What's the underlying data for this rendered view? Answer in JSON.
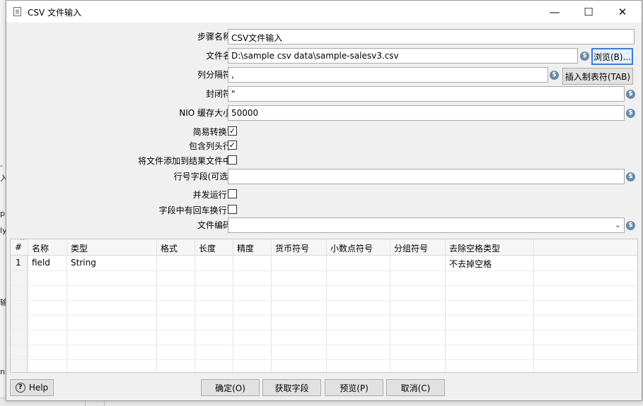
{
  "window": {
    "title": "CSV 文件输入",
    "minimize": "—",
    "maximize": "☐",
    "close": "✕"
  },
  "form": {
    "step_name": {
      "label": "步骤名称",
      "value": "CSV文件输入"
    },
    "filename": {
      "label": "文件名",
      "value": "D:\\sample csv data\\sample-salesv3.csv",
      "browse": "浏览(B)..."
    },
    "delimiter": {
      "label": "列分隔符",
      "value": ",",
      "insert_tab": "插入制表符(TAB)"
    },
    "enclosure": {
      "label": "封闭符",
      "value": "\""
    },
    "nio_buffer": {
      "label": "NIO 缓存大小",
      "value": "50000"
    },
    "lazy_conversion": {
      "label": "简易转换?",
      "checked": true
    },
    "header_row": {
      "label": "包含列头行",
      "checked": true
    },
    "add_to_result": {
      "label": "将文件添加到结果文件中",
      "checked": false
    },
    "row_number_field": {
      "label": "行号字段(可选)",
      "value": ""
    },
    "parallel": {
      "label": "并发运行?",
      "checked": false
    },
    "newline_in_field": {
      "label": "字段中有回车换行?",
      "checked": false
    },
    "encoding": {
      "label": "文件编码",
      "value": ""
    }
  },
  "table": {
    "columns": [
      "#",
      "名称",
      "类型",
      "格式",
      "长度",
      "精度",
      "货币符号",
      "小数点符号",
      "分组符号",
      "去除空格类型"
    ],
    "rows": [
      [
        "1",
        "field",
        "String",
        "",
        "",
        "",
        "",
        "",
        "",
        "不去掉空格"
      ]
    ]
  },
  "buttons": {
    "help": "Help",
    "ok": "确定(O)",
    "get_fields": "获取字段",
    "preview": "预览(P)",
    "cancel": "取消(C)"
  },
  "background_fragments": [
    "-",
    "入",
    "p",
    "ly",
    "输",
    "n"
  ],
  "icons": {
    "variable": "variable-icon",
    "help": "help-icon",
    "check": "✓"
  },
  "colors": {
    "focus_border": "#3d7bd0",
    "variable_icon": "#6a8aa8"
  }
}
